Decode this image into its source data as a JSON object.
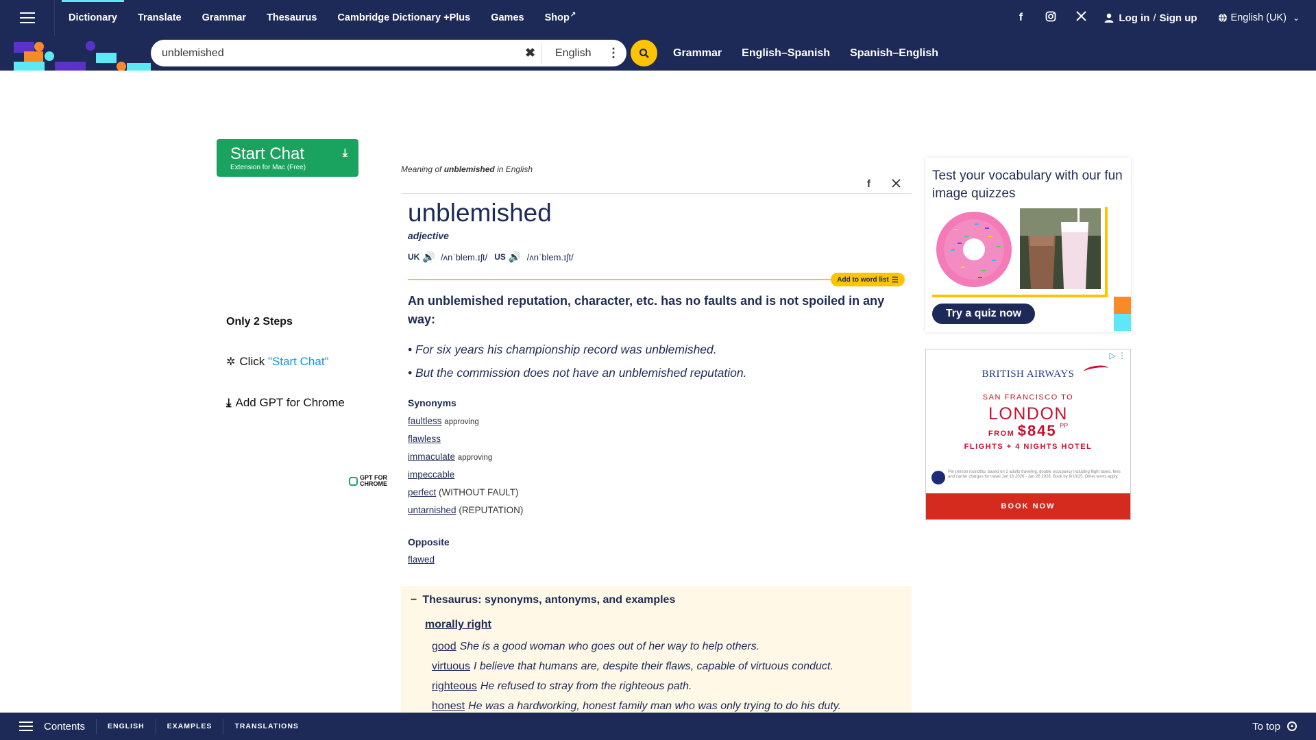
{
  "topnav": {
    "items": [
      {
        "label": "Dictionary"
      },
      {
        "label": "Translate"
      },
      {
        "label": "Grammar"
      },
      {
        "label": "Thesaurus"
      },
      {
        "label": "Cambridge Dictionary +Plus"
      },
      {
        "label": "Games"
      },
      {
        "label": "Shop"
      }
    ],
    "active": "Dictionary",
    "login": "Log in",
    "signup": "Sign up",
    "login_sep": "/",
    "language": "English (UK)"
  },
  "search": {
    "value": "unblemished",
    "dictionary": "English",
    "links": [
      "Grammar",
      "English–Spanish",
      "Spanish–English"
    ]
  },
  "left_ad": {
    "button_title": "Start Chat",
    "button_sub": "Extension for Mac (Free)",
    "steps_title": "Only 2 Steps",
    "step1_prefix": "Click ",
    "step1_highlight": "\"Start Chat\"",
    "step2": "Add GPT for Chrome",
    "logo_line1": "GPT FOR",
    "logo_line2": "CHROME"
  },
  "entry": {
    "meaning_prefix": "Meaning of ",
    "meaning_word": "unblemished",
    "meaning_suffix": " in English",
    "headword": "unblemished",
    "pos": "adjective",
    "uk_label": "UK",
    "uk_ipa": "/ʌnˈblem.ɪʃt/",
    "us_label": "US",
    "us_ipa": "/ʌnˈblem.ɪʃt/",
    "add_to_word_list": "Add to word list",
    "definition": "An unblemished reputation, character, etc. has no faults and is not spoiled in any way:",
    "examples": [
      "For six years his championship record was unblemished.",
      "But the commission does not have an unblemished reputation."
    ],
    "synonyms_title": "Synonyms",
    "synonyms": [
      {
        "word": "faultless",
        "label": "approving"
      },
      {
        "word": "flawless",
        "label": ""
      },
      {
        "word": "immaculate",
        "label": "approving"
      },
      {
        "word": "impeccable",
        "label": ""
      },
      {
        "word": "perfect",
        "label": "(WITHOUT FAULT)"
      },
      {
        "word": "untarnished",
        "label": "(REPUTATION)"
      }
    ],
    "opposite_title": "Opposite",
    "opposite": "flawed"
  },
  "thesaurus": {
    "title": "Thesaurus: synonyms, antonyms, and examples",
    "sense": "morally right",
    "rows": [
      {
        "word": "good",
        "example": "She is a good woman who goes out of her way to help others."
      },
      {
        "word": "virtuous",
        "example": "I believe that humans are, despite their flaws, capable of virtuous conduct."
      },
      {
        "word": "righteous",
        "example": "He refused to stray from the righteous path."
      },
      {
        "word": "honest",
        "example": "He was a hardworking, honest family man who was only trying to do his duty."
      }
    ]
  },
  "quiz": {
    "title": "Test your vocabulary with our fun image quizzes",
    "button": "Try a quiz now"
  },
  "ba_ad": {
    "brand": "BRITISH AIRWAYS",
    "route": "SAN FRANCISCO TO",
    "city": "LONDON",
    "from": "FROM",
    "price": "$845",
    "pp": "PP",
    "offer": "FLIGHTS + 4 NIGHTS HOTEL",
    "fine": "Per person roundtrip, based on 2 adults traveling, double occupancy including flight taxes, fees and carrier charges for travel Jan 16 2026 - Jan 26 2026. Book by 9/18/25. Other terms apply.",
    "cta": "BOOK NOW"
  },
  "bottombar": {
    "contents": "Contents",
    "links": [
      "ENGLISH",
      "EXAMPLES",
      "TRANSLATIONS"
    ],
    "to_top": "To top"
  },
  "colors": {
    "navy": "#1d2a57",
    "yellow": "#fec400",
    "green": "#1aa35f",
    "ba_red": "#c8102e"
  }
}
